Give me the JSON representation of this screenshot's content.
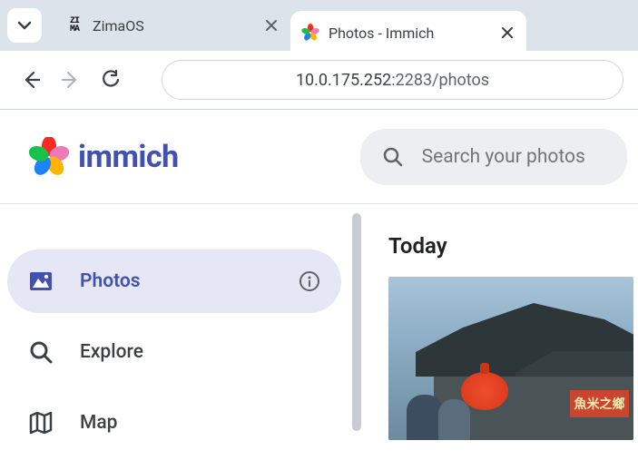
{
  "browser": {
    "tabs": [
      {
        "title": "ZimaOS",
        "active": false
      },
      {
        "title": "Photos - Immich",
        "active": true
      }
    ],
    "url_host": "10.0.175.252",
    "url_port_path": ":2283/photos"
  },
  "app": {
    "logo_text": "immich",
    "search_placeholder": "Search your photos",
    "sidebar": {
      "items": [
        {
          "label": "Photos",
          "active": true,
          "icon": "photos"
        },
        {
          "label": "Explore",
          "active": false,
          "icon": "search"
        },
        {
          "label": "Map",
          "active": false,
          "icon": "map"
        }
      ]
    },
    "content": {
      "section_title": "Today",
      "photo_sign_text": "魚米之鄉"
    }
  },
  "colors": {
    "accent": "#4250af",
    "sidebar_active_bg": "#e5e8f4"
  }
}
